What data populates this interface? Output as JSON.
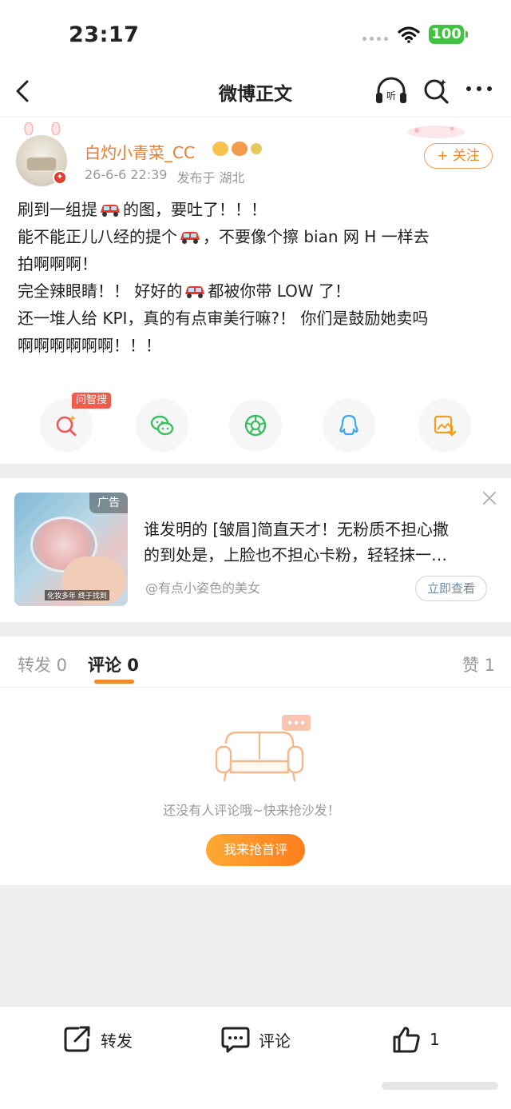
{
  "status_bar": {
    "time": "23:17",
    "battery": "100"
  },
  "nav": {
    "title": "微博正文",
    "icons": [
      "back-icon",
      "listen-icon",
      "ai-search-icon",
      "more-icon"
    ]
  },
  "post": {
    "username": "白灼小青菜_CC",
    "date": "26-6-6 22:39",
    "location": "发布于 湖北",
    "follow_label": "+ 关注",
    "lines": [
      {
        "before": "刷到一组提",
        "after": "的图，要吐了！！！"
      },
      {
        "before": "能不能正儿八经的提个",
        "after": "，不要像个擦 bian 网 H 一样去"
      },
      {
        "before": "拍啊啊啊！",
        "after": ""
      },
      {
        "before": "完全辣眼睛！！ 好好的",
        "after": "都被你带 LOW 了！"
      },
      {
        "before": "还一堆人给 KPI，真的有点审美行嘛?！ 你们是鼓励她卖吗",
        "after": ""
      },
      {
        "before": "啊啊啊啊啊啊！！！",
        "after": ""
      }
    ],
    "ai_tag": "问智搜",
    "share_icons": [
      "ai-search-icon",
      "wechat-icon",
      "moments-icon",
      "qq-icon",
      "save-image-icon"
    ]
  },
  "ad": {
    "tag": "广告",
    "text_line1": "谁发明的 [皱眉]简直天才！无粉质不担心撒",
    "text_line2": "的到处是，上脸也不担心卡粉，轻轻抹一…",
    "source": "@有点小姿色的美女",
    "cta": "立即查看",
    "image_caption": "化妆多年 终于找到"
  },
  "tabs": {
    "repost": "转发 0",
    "comment": "评论 0",
    "like": "赞 1",
    "active": "comment"
  },
  "empty_state": {
    "message": "还没有人评论哦~快来抢沙发！",
    "button": "我来抢首评"
  },
  "bottom_bar": {
    "repost": "转发",
    "comment": "评论",
    "like_count": "1"
  },
  "colors": {
    "accent": "#f08a2e",
    "username": "#eb7b2e",
    "battery": "#3ec43e"
  }
}
